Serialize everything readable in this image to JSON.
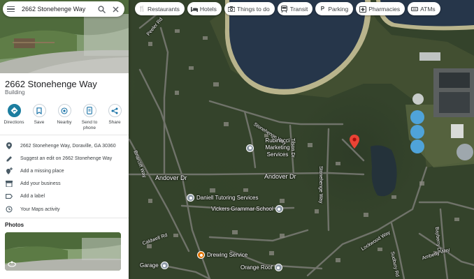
{
  "search": {
    "value": "2662 Stonehenge Way"
  },
  "place": {
    "title": "2662 Stonehenge Way",
    "type": "Building"
  },
  "actions": [
    {
      "label": "Directions",
      "icon": "directions-icon"
    },
    {
      "label": "Save",
      "icon": "bookmark-icon"
    },
    {
      "label": "Nearby",
      "icon": "nearby-icon"
    },
    {
      "label": "Send to phone",
      "icon": "phone-icon"
    },
    {
      "label": "Share",
      "icon": "share-icon"
    }
  ],
  "details": [
    {
      "text": "2662 Stonehenge Way, Doraville, GA 30360",
      "icon": "location-pin-icon"
    },
    {
      "text": "Suggest an edit on 2662 Stonehenge Way",
      "icon": "pencil-icon"
    },
    {
      "text": "Add a missing place",
      "icon": "add-place-icon"
    },
    {
      "text": "Add your business",
      "icon": "storefront-icon"
    },
    {
      "text": "Add a label",
      "icon": "label-icon"
    },
    {
      "text": "Your Maps activity",
      "icon": "history-icon"
    }
  ],
  "photos": {
    "title": "Photos"
  },
  "chips": [
    {
      "label": "Restaurants",
      "icon": "restaurant-icon"
    },
    {
      "label": "Hotels",
      "icon": "hotel-icon"
    },
    {
      "label": "Things to do",
      "icon": "camera-icon"
    },
    {
      "label": "Transit",
      "icon": "transit-icon"
    },
    {
      "label": "Parking",
      "icon": "parking-icon"
    },
    {
      "label": "Pharmacies",
      "icon": "pharmacy-icon"
    },
    {
      "label": "ATMs",
      "icon": "atm-icon"
    }
  ],
  "map": {
    "streets": {
      "peeler_rd": "Peeler Rd",
      "andover_dr": "Andover Dr",
      "andover_dr_2": "Andover Dr",
      "stonehenge_way": "Stonehenge Way",
      "lockwood": "Lockwood Way",
      "amberly_way": "Amberly Way",
      "sudbury_rd": "Sudbury Rd",
      "stonehenge_way_2": "Stonehenge Way",
      "tilson": "Tilson Dr",
      "briar": "Briarcliff Way",
      "caldwell": "Caldwell Rd",
      "bayberry": "Bayberry Dr"
    },
    "pois": [
      {
        "name": "Rubinacci Marketing Services",
        "icon": "business-icon",
        "color": "#8d99a6"
      },
      {
        "name": "Daniell Tutoring Services",
        "icon": "school-icon",
        "color": "#8d99a6"
      },
      {
        "name": "Vickers Grammar School",
        "icon": "school-icon",
        "color": "#8d99a6"
      },
      {
        "name": "Drewing Service",
        "icon": "service-icon",
        "color": "#e37400"
      },
      {
        "name": "Orange Roof",
        "icon": "business-icon",
        "color": "#8d99a6"
      },
      {
        "name": "Garage",
        "icon": "business-icon",
        "color": "#8d99a6"
      }
    ],
    "marker_color": "#ea4335"
  }
}
